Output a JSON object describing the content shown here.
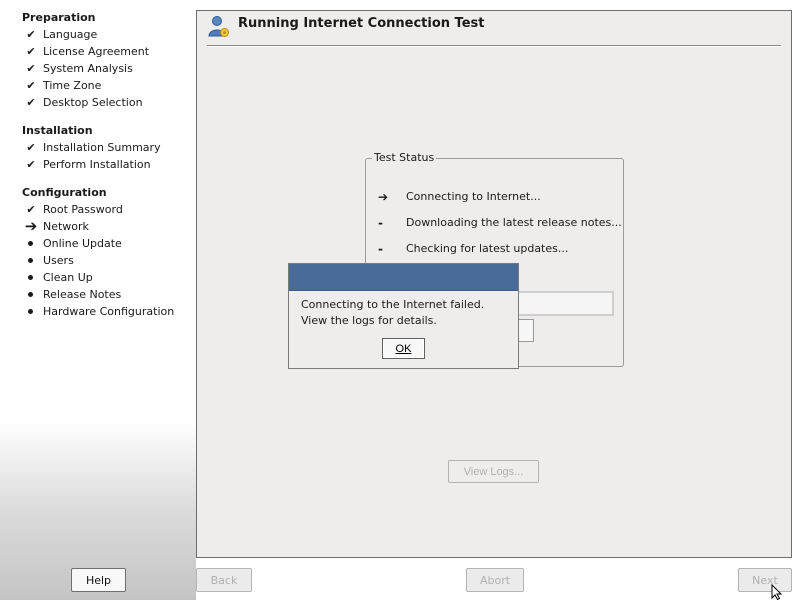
{
  "sidebar": {
    "preparation": {
      "title": "Preparation",
      "items": [
        {
          "label": "Language",
          "state": "done"
        },
        {
          "label": "License Agreement",
          "state": "done"
        },
        {
          "label": "System Analysis",
          "state": "done"
        },
        {
          "label": "Time Zone",
          "state": "done"
        },
        {
          "label": "Desktop Selection",
          "state": "done"
        }
      ]
    },
    "installation": {
      "title": "Installation",
      "items": [
        {
          "label": "Installation Summary",
          "state": "done"
        },
        {
          "label": "Perform Installation",
          "state": "done"
        }
      ]
    },
    "configuration": {
      "title": "Configuration",
      "items": [
        {
          "label": "Root Password",
          "state": "done"
        },
        {
          "label": "Network",
          "state": "current"
        },
        {
          "label": "Online Update",
          "state": "pending"
        },
        {
          "label": "Users",
          "state": "pending"
        },
        {
          "label": "Clean Up",
          "state": "pending"
        },
        {
          "label": "Release Notes",
          "state": "pending"
        },
        {
          "label": "Hardware Configuration",
          "state": "pending"
        }
      ]
    }
  },
  "main": {
    "title": "Running Internet Connection Test",
    "title_icon": "user-network-icon",
    "status_group": {
      "title": "Test Status",
      "rows": [
        {
          "mark": "➔",
          "text": "Connecting to Internet..."
        },
        {
          "mark": "-",
          "text": "Downloading the latest release notes..."
        },
        {
          "mark": "-",
          "text": "Checking for latest updates..."
        }
      ]
    },
    "view_logs_label": "View Logs..."
  },
  "footer": {
    "help_label": "Help",
    "back_label": "Back",
    "abort_label": "Abort",
    "next_label": "Next"
  },
  "dialog": {
    "message": "Connecting to the Internet failed. View the logs for details.",
    "ok_label": "OK"
  },
  "colors": {
    "dialog_titlebar": "#4a6a9a",
    "panel_bg": "#efedeb",
    "disabled_text": "#b0b0b0"
  }
}
